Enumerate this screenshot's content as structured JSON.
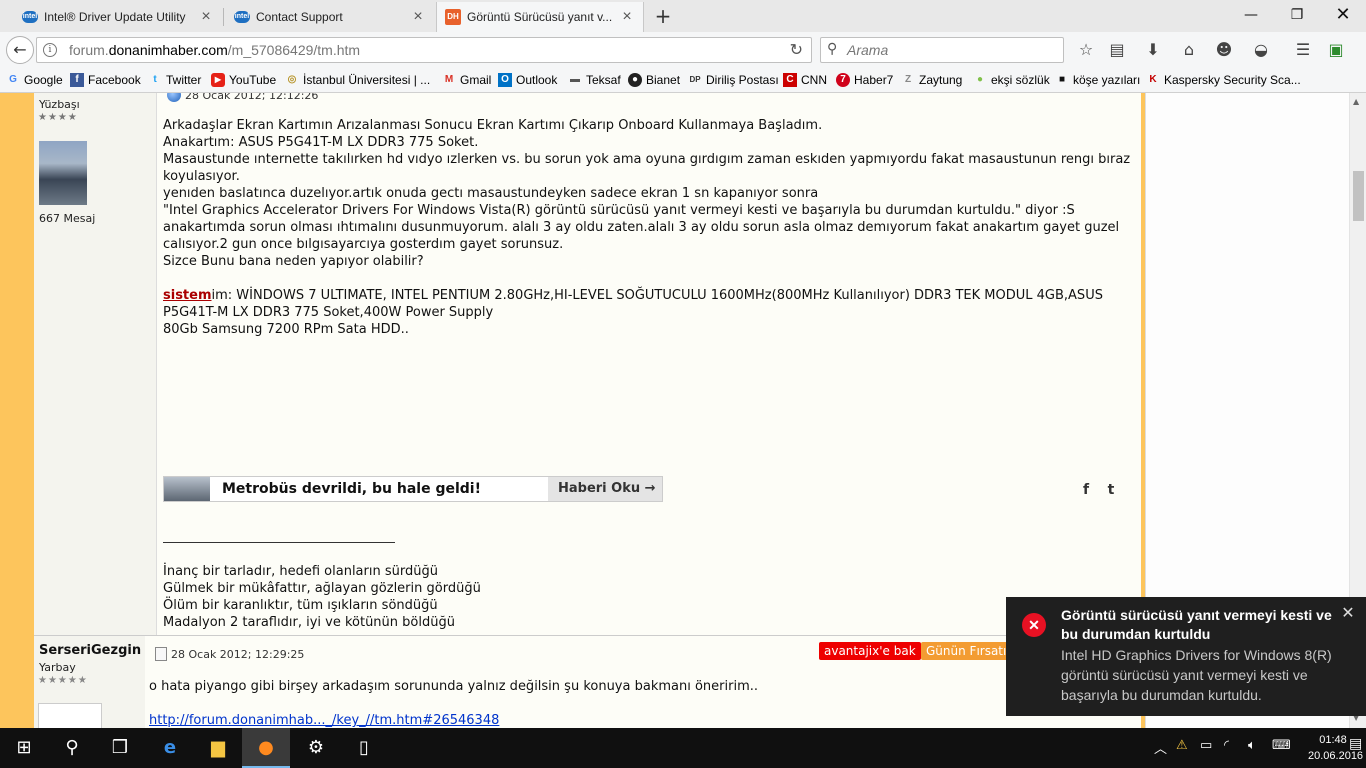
{
  "tabs": [
    {
      "label": "Intel® Driver Update Utility",
      "icon": "intel-icon"
    },
    {
      "label": "Contact Support",
      "icon": "intel-icon"
    },
    {
      "label": "Görüntü Sürücüsü yanıt v...",
      "icon": "dh-icon",
      "icon_text": "DH"
    }
  ],
  "address": {
    "prefix": "forum.",
    "domain": "donanimhaber.com",
    "path": "/m_57086429/tm.htm"
  },
  "search": {
    "placeholder": "Arama"
  },
  "bookmarks": [
    {
      "label": "Google",
      "icon": "google-icon",
      "color": "#4285f4",
      "glyph": "G"
    },
    {
      "label": "Facebook",
      "icon": "facebook-icon",
      "color": "#3b5998",
      "glyph": "f"
    },
    {
      "label": "Twitter",
      "icon": "twitter-icon",
      "color": "#1da1f2",
      "glyph": "t"
    },
    {
      "label": "YouTube",
      "icon": "youtube-icon",
      "color": "#e62117",
      "glyph": "▶"
    },
    {
      "label": "İstanbul Üniversitesi | ...",
      "icon": "istanbul-univ-icon",
      "color": "#b8962e",
      "glyph": "◎"
    },
    {
      "label": "Gmail",
      "icon": "gmail-icon",
      "color": "#d93025",
      "glyph": "M"
    },
    {
      "label": "Outlook",
      "icon": "outlook-icon",
      "color": "#0072c6",
      "glyph": "O"
    },
    {
      "label": "Teksaf",
      "icon": "teksaf-icon",
      "color": "#555555",
      "glyph": "▬"
    },
    {
      "label": "Bianet",
      "icon": "bianet-icon",
      "color": "#222222",
      "glyph": "●"
    },
    {
      "label": "Diriliş Postası",
      "icon": "dirilis-icon",
      "color": "#333333",
      "glyph": "DP"
    },
    {
      "label": "CNN",
      "icon": "cnn-icon",
      "color": "#cc0000",
      "glyph": "C"
    },
    {
      "label": "Haber7",
      "icon": "haber7-icon",
      "color": "#d0021b",
      "glyph": "7"
    },
    {
      "label": "Zaytung",
      "icon": "zaytung-icon",
      "color": "#888888",
      "glyph": "Z"
    },
    {
      "label": "ekşi sözlük",
      "icon": "eksi-icon",
      "color": "#81c14b",
      "glyph": "●"
    },
    {
      "label": "köşe yazıları",
      "icon": "kose-icon",
      "color": "#111111",
      "glyph": "■"
    },
    {
      "label": "Kaspersky Security Sca...",
      "icon": "kaspersky-icon",
      "color": "#c40000",
      "glyph": "K"
    }
  ],
  "post1": {
    "rank": "Yüzbaşı",
    "stars": "★★★★",
    "message_count": "667 Mesaj",
    "date": "28 Ocak 2012; 12:12:26",
    "body": [
      "Arkadaşlar Ekran Kartımın Arızalanması Sonucu Ekran Kartımı Çıkarıp Onboard Kullanmaya Başladım.",
      "Anakartım: ASUS P5G41T-M LX DDR3 775 Soket.",
      "Masaustunde ınternette takılırken hd vıdyo ızlerken vs. bu sorun yok ama oyuna gırdıgım zaman eskıden yapmıyordu fakat masaustunun rengı bıraz koyulasıyor.",
      "yenıden baslatınca duzelıyor.artık onuda gectı masaustundeyken sadece ekran 1 sn kapanıyor sonra",
      "\"Intel Graphics Accelerator Drivers For Windows Vista(R) görüntü sürücüsü yanıt vermeyi kesti ve başarıyla bu durumdan kurtuldu.\" diyor :S anakartımda sorun olması ıhtımalını dusunmuyorum. alalı 3 ay oldu zaten.alalı 3 ay oldu sorun asla olmaz demıyorum fakat anakartım gayet guzel calısıyor.2 gun once bılgısayarcıya gosterdım gayet sorunsuz.",
      "Sizce Bunu bana neden yapıyor olabilir?"
    ],
    "system_link": "sistem",
    "system_rest": "im: WİNDOWS 7 ULTIMATE, INTEL PENTIUM 2.80GHz,HI-LEVEL SOĞUTUCULU 1600MHz(800MHz Kullanılıyor) DDR3 TEK MODUL 4GB,ASUS P5G41T-M LX DDR3 775 Soket,400W Power Supply",
    "system_line2": "80Gb Samsung 7200 RPm Sata HDD..",
    "news_title": "Metrobüs devrildi, bu hale geldi!",
    "news_button": "Haberi Oku →",
    "signature": [
      "İnanç bir tarladır, hedefi olanların sürdüğü",
      "Gülmek bir mükâfattır, ağlayan gözlerin gördüğü",
      "Ölüm bir karanlıktır, tüm ışıkların söndüğü",
      "Madalyon 2 taraflıdır, iyi ve kötünün böldüğü"
    ]
  },
  "post2": {
    "username": "SerseriGezgin",
    "rank": "Yarbay",
    "stars": "★★★★★",
    "date": "28 Ocak 2012; 12:29:25",
    "badge_red": "avantajix'e bak",
    "badge_orange": "Günün Fırsatı",
    "text": "o hata piyango gibi birşey arkadaşım sorununda yalnız değilsin şu konuya bakmanı öneririm..",
    "link": "http://forum.donanimhab..._/key_//tm.htm#26546348"
  },
  "toast": {
    "title": "Görüntü sürücüsü yanıt vermeyi kesti ve bu durumdan kurtuldu",
    "body": "Intel HD Graphics Drivers for Windows 8(R) görüntü sürücüsü yanıt vermeyi kesti ve başarıyla bu durumdan kurtuldu."
  },
  "clock": {
    "time": "01:48",
    "date": "20.06.2016"
  },
  "colors": {
    "accent_orange": "#fdc55c",
    "toast_bg": "#1f1f1f",
    "error_red": "#e81123"
  }
}
